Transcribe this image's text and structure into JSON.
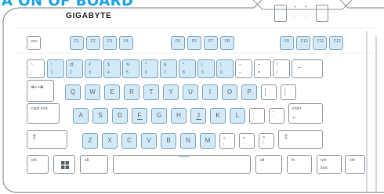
{
  "header": {
    "title": "A  ON OF BOARD"
  },
  "brand": "GIGABYTE",
  "panel": {
    "top_plus": "+",
    "top_minus": "−",
    "small_plus": "+",
    "small_minus": "−"
  },
  "rows": {
    "fn": [
      "esc",
      "F1",
      "F2",
      "F3",
      "F4",
      "F5",
      "F6",
      "F7",
      "F8",
      "F9",
      "F10",
      "F11",
      "F12"
    ],
    "num": [
      [
        "~",
        "`"
      ],
      [
        "!",
        "1"
      ],
      [
        "@",
        "2"
      ],
      [
        "#",
        "3"
      ],
      [
        "$",
        "4"
      ],
      [
        "%",
        "5"
      ],
      [
        "^",
        "6"
      ],
      [
        "&",
        "7"
      ],
      [
        "*",
        "8"
      ],
      [
        "(",
        "9"
      ],
      [
        ")",
        "0"
      ],
      [
        "−",
        "–"
      ],
      [
        "+",
        "="
      ],
      [
        "|",
        "\\"
      ],
      [
        "←",
        ""
      ]
    ],
    "qwerty": [
      "Q",
      "W",
      "E",
      "R",
      "T",
      "Y",
      "U",
      "I",
      "O",
      "P"
    ],
    "qwerty_extra": [
      [
        "{",
        "["
      ],
      [
        "}",
        "]"
      ]
    ],
    "tab": "⇤⇥",
    "caps": "caps lock",
    "asdf": [
      "A",
      "S",
      "D",
      "F",
      "G",
      "H",
      "J",
      "K",
      "L"
    ],
    "asdf_extra": [
      [
        ":",
        ";"
      ],
      [
        "\"",
        "'"
      ]
    ],
    "enter": [
      "enter",
      "↵"
    ],
    "shift": "⇧",
    "zxcv": [
      "Z",
      "X",
      "C",
      "V",
      "B",
      "N",
      "M"
    ],
    "zxcv_extra": [
      [
        "<",
        ","
      ],
      [
        ">",
        "."
      ],
      [
        "?",
        "/"
      ]
    ],
    "bottom": {
      "ctrl_left": "ctrl",
      "win_icon": "windows-icon",
      "alt_left": "alt",
      "alt_right": "alt",
      "fn": "fn",
      "winlock_1": "win",
      "winlock_2": "lock",
      "ctrl_right": "ctrl"
    }
  }
}
